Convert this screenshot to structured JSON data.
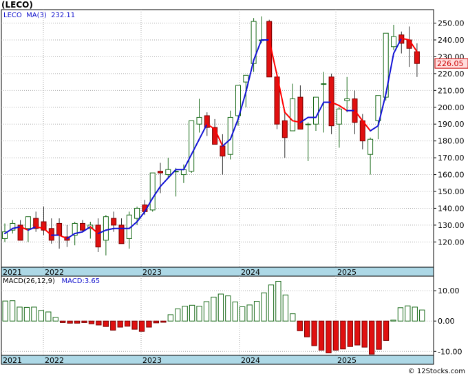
{
  "header": {
    "symbol": "(LECO)",
    "ma_label": "MA(3)",
    "ma_value": "232.11"
  },
  "macd_header": {
    "label": "MACD(26,12,9)",
    "value_label": "MACD:3.65"
  },
  "footer": {
    "credit": "© 12Stocks.com"
  },
  "colors": {
    "up_fill": "#ffffff",
    "up_stroke": "#1a6b1a",
    "down_fill": "#e01010",
    "ma_up": "#1414d6",
    "ma_down": "#ff0000",
    "axis_band": "#add8e6",
    "grid": "#aaaaaa",
    "price_tag_fill": "#ffdddd",
    "price_tag_text": "#cc0000"
  },
  "chart_data": [
    {
      "type": "candlestick",
      "name": "price",
      "ylim": [
        105,
        258
      ],
      "y_ticks": [
        120,
        130,
        140,
        150,
        160,
        170,
        180,
        190,
        200,
        210,
        220,
        230,
        240,
        250
      ],
      "x_labels": [
        "2021",
        "2022",
        "2023",
        "2024",
        "2025"
      ],
      "last_price": "226.05",
      "candles": [
        [
          122,
          131,
          120,
          126
        ],
        [
          127,
          133,
          125,
          131
        ],
        [
          130,
          133,
          122,
          121
        ],
        [
          128,
          134,
          120,
          135
        ],
        [
          134,
          138,
          126,
          128
        ],
        [
          132,
          141,
          124,
          127
        ],
        [
          128,
          134,
          119,
          121
        ],
        [
          131,
          134,
          116,
          124
        ],
        [
          123,
          130,
          117,
          121
        ],
        [
          124,
          132,
          118,
          131
        ],
        [
          131,
          133,
          126,
          127
        ],
        [
          128,
          132,
          122,
          130
        ],
        [
          130,
          134,
          114,
          117
        ],
        [
          121,
          136,
          112,
          135
        ],
        [
          134,
          138,
          126,
          130
        ],
        [
          130,
          134,
          121,
          119
        ],
        [
          122,
          138,
          116,
          136
        ],
        [
          134,
          141,
          130,
          140
        ],
        [
          142,
          145,
          136,
          138
        ],
        [
          139,
          149,
          138,
          161
        ],
        [
          162,
          167,
          149,
          161
        ],
        [
          160,
          170,
          158,
          163
        ],
        [
          162,
          164,
          147,
          162
        ],
        [
          160,
          166,
          155,
          163
        ],
        [
          162,
          172,
          161,
          192
        ],
        [
          190,
          205,
          185,
          194
        ],
        [
          195,
          197,
          183,
          188
        ],
        [
          188,
          193,
          178,
          178
        ],
        [
          177,
          184,
          160,
          171
        ],
        [
          172,
          198,
          169,
          194
        ],
        [
          195,
          212,
          189,
          213
        ],
        [
          215,
          218,
          200,
          219
        ],
        [
          226,
          253,
          221,
          251
        ],
        [
          240,
          254,
          238,
          240
        ],
        [
          251,
          252,
          218,
          218
        ],
        [
          218,
          221,
          187,
          190
        ],
        [
          192,
          198,
          170,
          182
        ],
        [
          186,
          214,
          186,
          205
        ],
        [
          206,
          213,
          200,
          187
        ],
        [
          190,
          191,
          168,
          190
        ],
        [
          190,
          205,
          186,
          206
        ],
        [
          214,
          221,
          185,
          214
        ],
        [
          218,
          220,
          184,
          189
        ],
        [
          190,
          200,
          176,
          199
        ],
        [
          204,
          218,
          197,
          205
        ],
        [
          205,
          210,
          184,
          191
        ],
        [
          192,
          196,
          175,
          180
        ],
        [
          172,
          182,
          160,
          181
        ],
        [
          192,
          206,
          181,
          207
        ],
        [
          206,
          240,
          204,
          244
        ],
        [
          236,
          249,
          234,
          242
        ],
        [
          243,
          245,
          232,
          238
        ],
        [
          240,
          248,
          224,
          235
        ],
        [
          233,
          238,
          218,
          226
        ]
      ],
      "ma3": [
        125,
        128,
        129,
        127,
        129,
        128,
        124,
        124,
        122,
        125,
        126,
        129,
        125,
        127,
        128,
        128,
        128,
        132,
        138,
        146,
        153,
        158,
        163,
        163,
        172,
        181,
        190,
        187,
        177,
        181,
        193,
        209,
        228,
        240,
        240,
        219,
        197,
        192,
        191,
        194,
        194,
        203,
        203,
        201,
        198,
        198,
        192,
        186,
        189,
        208,
        232,
        241,
        240,
        233
      ]
    },
    {
      "type": "bar",
      "name": "macd",
      "ylim": [
        -11.3,
        14.8
      ],
      "y_ticks": [
        10,
        0,
        -10
      ],
      "y_tick_labels": [
        "10.00",
        "0.00",
        "-10.00"
      ],
      "x_labels": [
        "2021",
        "2022",
        "2023",
        "2024",
        "2025"
      ],
      "values": [
        6.6,
        6.7,
        4.6,
        4.5,
        4.6,
        3.5,
        3.0,
        1.2,
        -0.5,
        -0.7,
        -0.7,
        -0.5,
        -0.9,
        -1.3,
        -1.8,
        -3.0,
        -2.0,
        -1.7,
        -2.7,
        -3.4,
        -2.0,
        -0.6,
        -0.4,
        2.1,
        4.0,
        4.9,
        5.2,
        4.9,
        6.4,
        7.9,
        8.9,
        8.3,
        6.3,
        4.7,
        5.3,
        6.5,
        9.3,
        11.9,
        13.1,
        8.6,
        2.4,
        -3.2,
        -5.2,
        -8.1,
        -9.6,
        -10.5,
        -9.6,
        -9.2,
        -8.4,
        -7.9,
        -8.6,
        -10.9,
        -9.3,
        -6.4,
        0.3,
        4.4,
        5.0,
        4.6,
        3.65
      ]
    }
  ]
}
